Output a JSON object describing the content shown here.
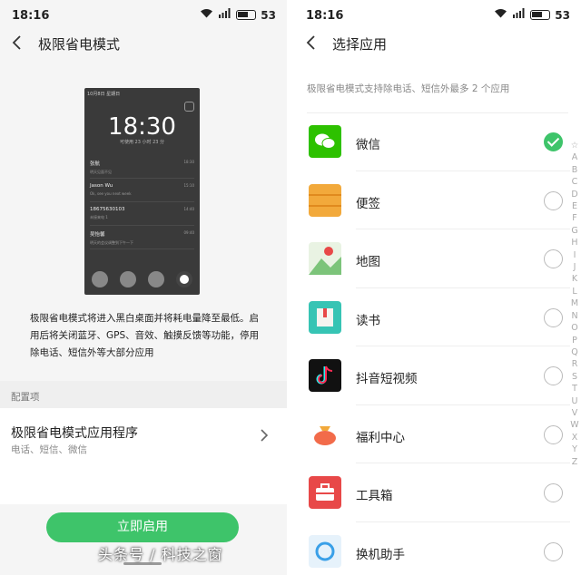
{
  "left": {
    "status": {
      "time": "18:16",
      "battery": "53"
    },
    "title": "极限省电模式",
    "preview": {
      "status_date": "10月8日 星期日",
      "clock": "18:30",
      "subline": "可使用 23 小时 23 分",
      "notifications": [
        {
          "name": "张航",
          "msg": "明天见面不见",
          "time": "18:30"
        },
        {
          "name": "Jason Wu",
          "msg": "Ok, see you next week",
          "time": "15:10"
        },
        {
          "name": "18675630103",
          "msg": "未接来电 1",
          "time": "14:40"
        },
        {
          "name": "吴怡馨",
          "msg": "明天的会议调整到下午一下",
          "time": "09:40"
        }
      ]
    },
    "description": "极限省电模式将进入黑白桌面并将耗电量降至最低。启用后将关闭蓝牙、GPS、音效、触摸反馈等功能，停用除电话、短信外等大部分应用",
    "section_label": "配置项",
    "config": {
      "title": "极限省电模式应用程序",
      "subtitle": "电话、短信、微信"
    },
    "enable_button": "立即启用"
  },
  "right": {
    "status": {
      "time": "18:16",
      "battery": "53"
    },
    "title": "选择应用",
    "hint": "极限省电模式支持除电话、短信外最多 2 个应用",
    "apps": [
      {
        "name": "微信",
        "checked": true,
        "icon": "wechat-icon",
        "color": "#2dc100"
      },
      {
        "name": "便签",
        "checked": false,
        "icon": "notes-icon",
        "color": "#f2a93b"
      },
      {
        "name": "地图",
        "checked": false,
        "icon": "map-icon",
        "color": "#7cc47a"
      },
      {
        "name": "读书",
        "checked": false,
        "icon": "book-icon",
        "color": "#36c4b4"
      },
      {
        "name": "抖音短视频",
        "checked": false,
        "icon": "douyin-icon",
        "color": "#111111"
      },
      {
        "name": "福利中心",
        "checked": false,
        "icon": "gift-bag-icon",
        "color": "#f26b4a"
      },
      {
        "name": "工具箱",
        "checked": false,
        "icon": "toolbox-icon",
        "color": "#e84848"
      },
      {
        "name": "换机助手",
        "checked": false,
        "icon": "phone-switch-icon",
        "color": "#3aa0e8"
      }
    ],
    "index": [
      "☆",
      "A",
      "B",
      "C",
      "D",
      "E",
      "F",
      "G",
      "H",
      "I",
      "J",
      "K",
      "L",
      "M",
      "N",
      "O",
      "P",
      "Q",
      "R",
      "S",
      "T",
      "U",
      "V",
      "W",
      "X",
      "Y",
      "Z"
    ]
  },
  "watermark": "头条号 / 科技之窗"
}
